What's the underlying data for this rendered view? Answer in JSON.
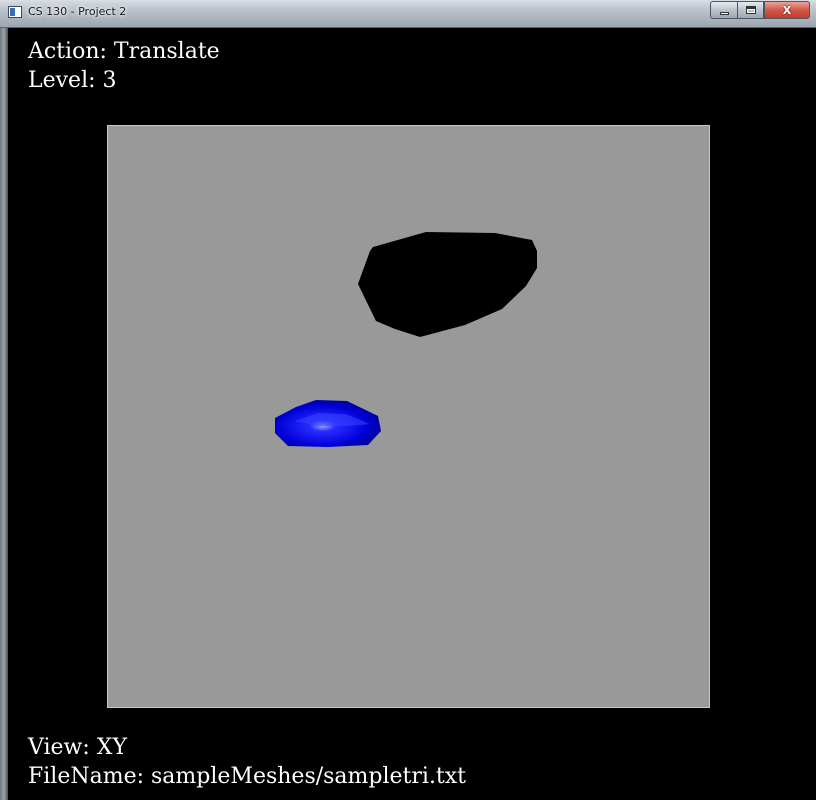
{
  "window": {
    "title": "CS 130 - Project 2",
    "buttons": {
      "minimize_icon": "minimize-icon",
      "maximize_icon": "maximize-icon",
      "close_label": "X"
    }
  },
  "hud": {
    "action": "Action: Translate",
    "level": "Level: 3",
    "view": "View: XY",
    "filename": "FileName: sampleMeshes/sampletri.txt"
  },
  "scene": {
    "background_color": "#999999",
    "black_mesh_color": "#000000",
    "blue_mesh_color": "#0000e0"
  }
}
